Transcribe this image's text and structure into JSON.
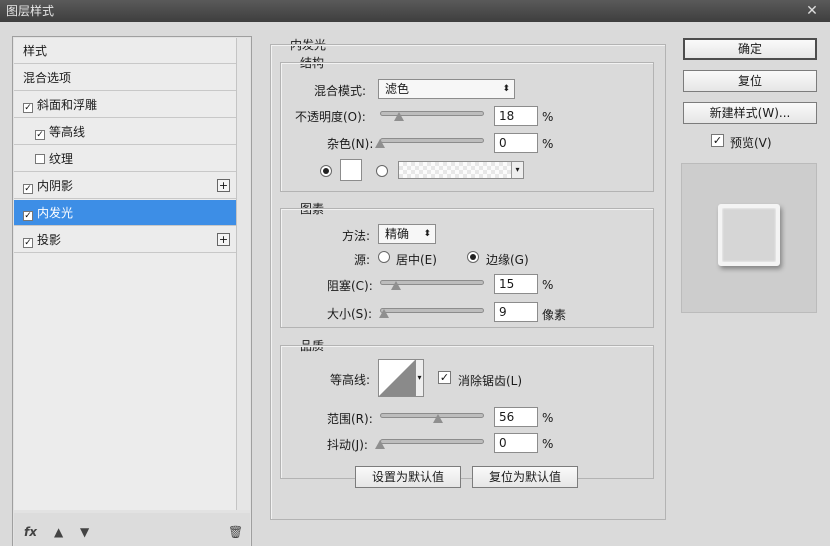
{
  "window": {
    "title": "图层样式"
  },
  "sidebar": {
    "items": [
      {
        "label": "样式",
        "checkbox": false,
        "checked": false,
        "plus": false
      },
      {
        "label": "混合选项",
        "checkbox": false,
        "checked": false,
        "plus": false
      },
      {
        "label": "斜面和浮雕",
        "checkbox": true,
        "checked": true,
        "plus": false
      },
      {
        "label": "等高线",
        "checkbox": true,
        "checked": true,
        "plus": false
      },
      {
        "label": "纹理",
        "checkbox": true,
        "checked": false,
        "plus": false
      },
      {
        "label": "内阴影",
        "checkbox": true,
        "checked": true,
        "plus": true
      },
      {
        "label": "内发光",
        "checkbox": true,
        "checked": true,
        "plus": false,
        "selected": true
      },
      {
        "label": "投影",
        "checkbox": true,
        "checked": true,
        "plus": true
      }
    ],
    "footer_fx": "fx"
  },
  "panel": {
    "title": "内发光",
    "structure": {
      "title": "结构",
      "blend_mode_label": "混合模式:",
      "blend_mode_value": "滤色",
      "opacity_label": "不透明度(O):",
      "opacity_value": "18",
      "opacity_unit": "%",
      "opacity_level": 18,
      "noise_label": "杂色(N):",
      "noise_value": "0",
      "noise_unit": "%",
      "noise_level": 0
    },
    "elements": {
      "title": "图素",
      "method_label": "方法:",
      "method_value": "精确",
      "source_label": "源:",
      "source_center": "居中(E)",
      "source_edge": "边缘(G)",
      "choke_label": "阻塞(C):",
      "choke_value": "15",
      "choke_unit": "%",
      "choke_level": 15,
      "size_label": "大小(S):",
      "size_value": "9",
      "size_unit": "像素",
      "size_level": 4
    },
    "quality": {
      "title": "品质",
      "contour_label": "等高线:",
      "antialias_label": "消除锯齿(L)",
      "range_label": "范围(R):",
      "range_value": "56",
      "range_unit": "%",
      "range_level": 56,
      "jitter_label": "抖动(J):",
      "jitter_value": "0",
      "jitter_unit": "%",
      "jitter_level": 0
    },
    "make_default": "设置为默认值",
    "reset_default": "复位为默认值"
  },
  "actions": {
    "ok": "确定",
    "reset": "复位",
    "new_style": "新建样式(W)...",
    "preview": "预览(V)"
  },
  "colors": {
    "selected": "#3d8ee6",
    "glow_color": "#ffffff"
  }
}
